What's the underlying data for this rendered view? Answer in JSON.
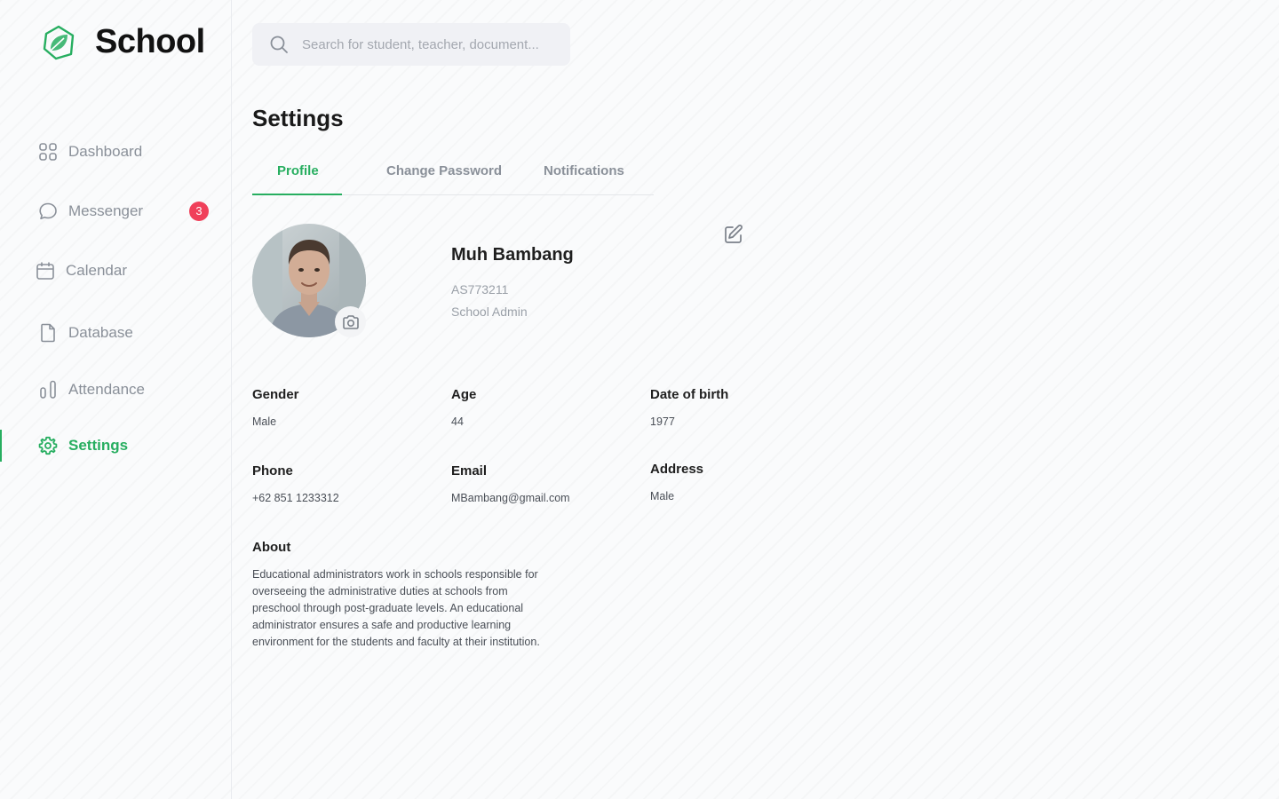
{
  "brand": {
    "name": "School",
    "logo_icon": "leaf-logo-icon"
  },
  "sidebar": {
    "items": [
      {
        "label": "Dashboard",
        "icon": "grid-icon",
        "active": false
      },
      {
        "label": "Messenger",
        "icon": "chat-icon",
        "active": false,
        "badge": "3"
      },
      {
        "label": "Calendar",
        "icon": "calendar-icon",
        "active": false
      },
      {
        "label": "Database",
        "icon": "file-icon",
        "active": false
      },
      {
        "label": "Attendance",
        "icon": "bar-chart-icon",
        "active": false
      },
      {
        "label": "Settings",
        "icon": "gear-icon",
        "active": true
      }
    ]
  },
  "search": {
    "placeholder": "Search for student, teacher, document..."
  },
  "page": {
    "title": "Settings"
  },
  "tabs": [
    {
      "label": "Profile",
      "active": true
    },
    {
      "label": "Change Password",
      "active": false
    },
    {
      "label": "Notifications",
      "active": false
    }
  ],
  "profile": {
    "name": "Muh Bambang",
    "id": "AS773211",
    "role": "School Admin",
    "fields": {
      "gender": {
        "label": "Gender",
        "value": "Male"
      },
      "age": {
        "label": "Age",
        "value": "44"
      },
      "dob": {
        "label": "Date of birth",
        "value": "1977"
      },
      "phone": {
        "label": "Phone",
        "value": "+62 851 1233312"
      },
      "email": {
        "label": "Email",
        "value": "MBambang@gmail.com"
      },
      "address": {
        "label": "Address",
        "value": "Male"
      }
    },
    "about": {
      "label": "About",
      "text": "Educational administrators work in schools responsible for overseeing the administrative duties at schools from preschool through post-graduate levels. An educational administrator ensures a safe and productive learning environment for the students and faculty at their institution."
    }
  },
  "colors": {
    "accent": "#27ae60",
    "badge": "#f0405a",
    "muted": "#8a9099"
  }
}
